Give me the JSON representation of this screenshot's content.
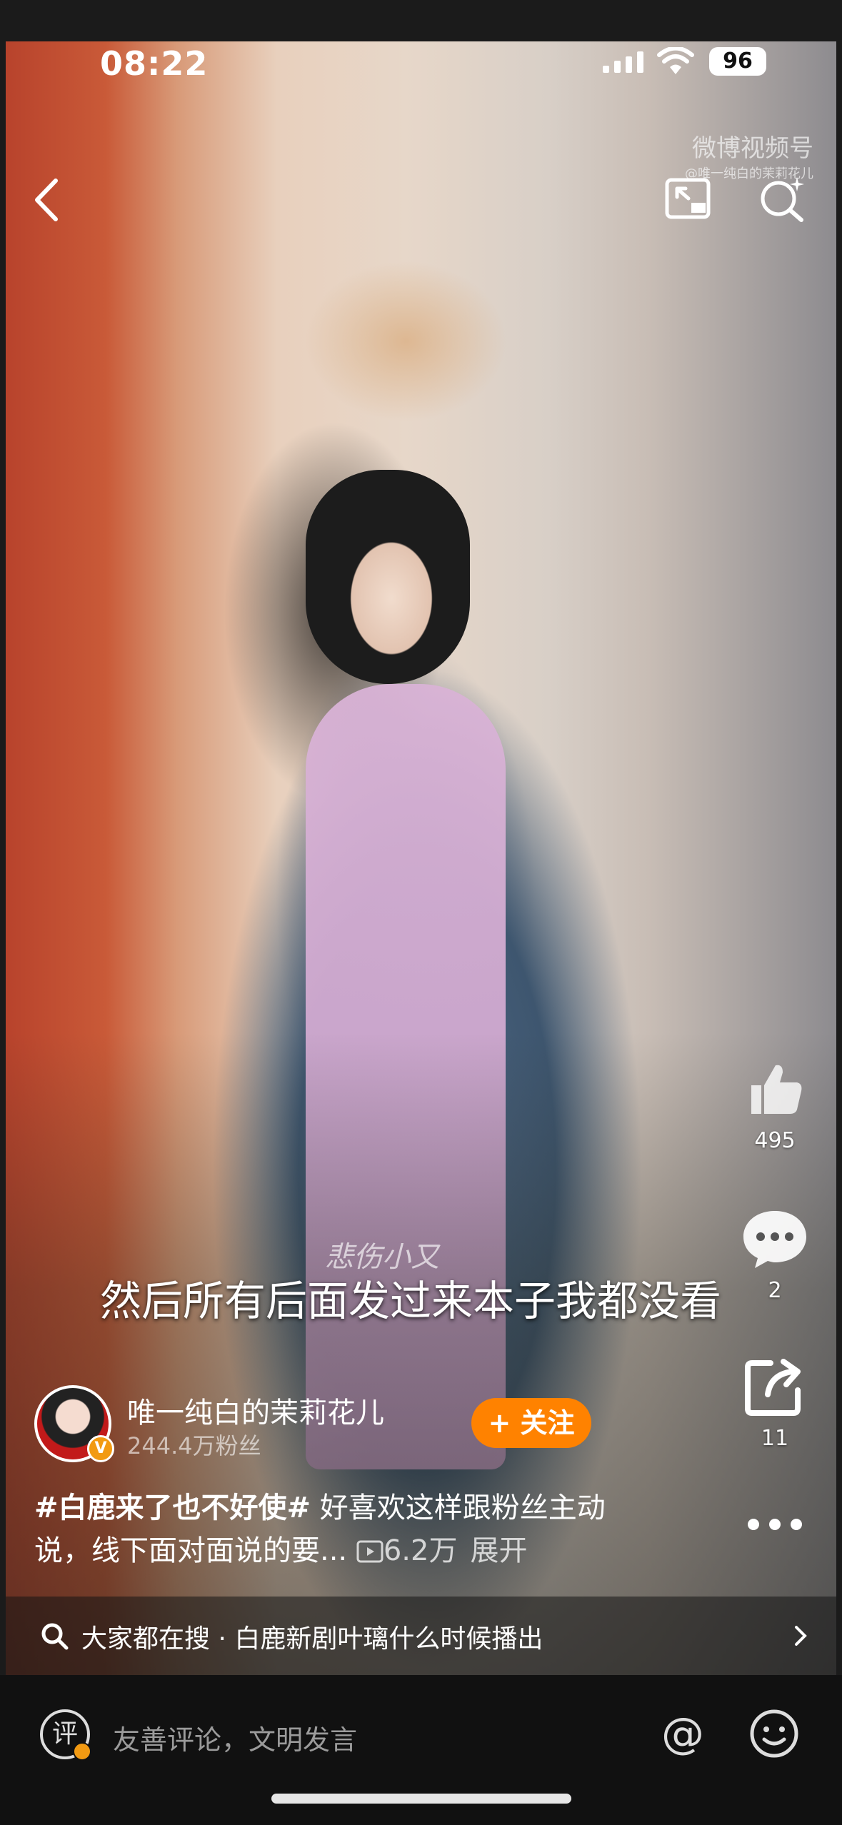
{
  "status": {
    "time": "08:22",
    "battery": "96"
  },
  "watermark": {
    "brand": "微博视频号",
    "handle": "@唯一纯白的茉莉花儿"
  },
  "video": {
    "caption_small": "悲伤小又",
    "caption": "然后所有后面发过来本子我都没看"
  },
  "actions": {
    "like_count": "495",
    "comment_count": "2",
    "share_count": "11"
  },
  "author": {
    "name": "唯一纯白的茉莉花儿",
    "fans": "244.4万粉丝",
    "verify_badge": "V",
    "follow_label": "+ 关注"
  },
  "description": {
    "hashtag": "#白鹿来了也不好使#",
    "text": " 好喜欢这样跟粉丝主动说，线下面对面说的要... ",
    "views": "6.2万",
    "expand_label": "展开"
  },
  "search": {
    "text": "大家都在搜 · 白鹿新剧叶璃什么时候播出"
  },
  "comment_bar": {
    "icon_label": "评",
    "placeholder": "友善评论，文明发言",
    "at_label": "@"
  }
}
